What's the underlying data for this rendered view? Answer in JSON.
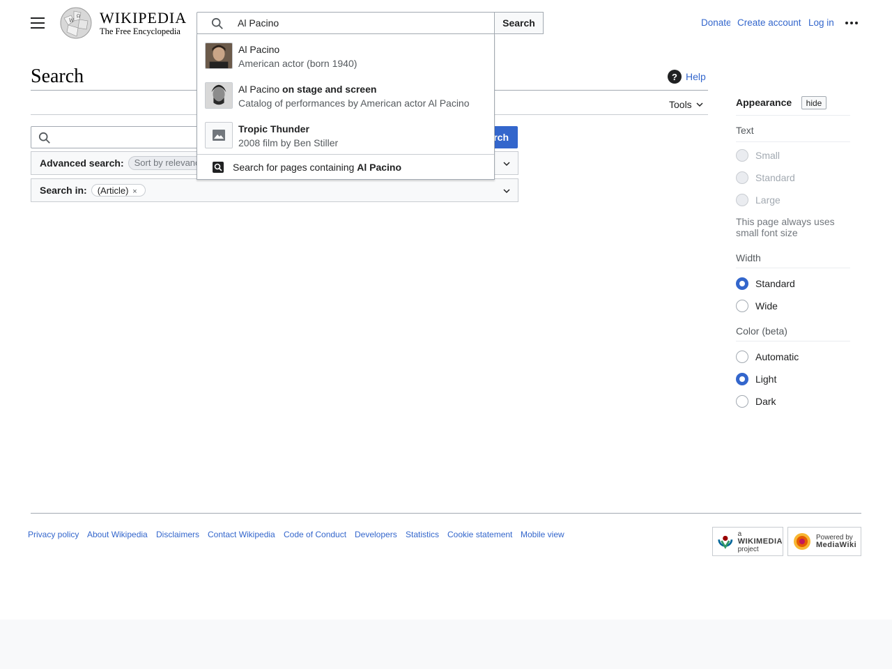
{
  "header": {
    "logo_word": "WIKIPEDIA",
    "logo_tagline": "The Free Encyclopedia",
    "search_value": "Al Pacino",
    "search_button": "Search",
    "links": {
      "donate": "Donate",
      "create_account": "Create account",
      "login": "Log in"
    }
  },
  "suggestions": {
    "items": [
      {
        "title": "Al Pacino",
        "title_suffix": "",
        "desc": "American actor (born 1940)"
      },
      {
        "title": "Al Pacino",
        "title_suffix": " on stage and screen",
        "desc": "Catalog of performances by American actor Al Pacino"
      },
      {
        "title": "Tropic Thunder",
        "title_suffix": "",
        "desc": "2008 film by Ben Stiller"
      }
    ],
    "full_text_prefix": "Search for pages containing ",
    "full_text_term": "Al Pacino"
  },
  "page": {
    "title": "Search",
    "help": "Help",
    "tools": "Tools"
  },
  "search_form": {
    "input_value": "",
    "button": "Search",
    "advanced_label": "Advanced search:",
    "sort_value": "Sort by relevance",
    "search_in_label": "Search in:",
    "namespace_chip": "(Article)",
    "namespace_remove": "×"
  },
  "appearance": {
    "heading": "Appearance",
    "hide": "hide",
    "text_label": "Text",
    "text_options": [
      "Small",
      "Standard",
      "Large"
    ],
    "text_note": "This page always uses small font size",
    "width_label": "Width",
    "width_options": [
      "Standard",
      "Wide"
    ],
    "color_label": "Color (beta)",
    "color_options": [
      "Automatic",
      "Light",
      "Dark"
    ]
  },
  "footer": {
    "links": {
      "privacy": "Privacy policy",
      "about": "About Wikipedia",
      "disclaimers": "Disclaimers",
      "contact": "Contact Wikipedia",
      "coc": "Code of Conduct",
      "developers": "Developers",
      "statistics": "Statistics",
      "cookie": "Cookie statement",
      "mobile": "Mobile view"
    },
    "wikimedia_badge_small": "a",
    "wikimedia_badge_big": "WIKIMEDIA",
    "wikimedia_badge_tail": "project",
    "mediawiki_badge_small": "Powered by",
    "mediawiki_badge_big": "MediaWiki"
  },
  "colors": {
    "link": "#3366cc",
    "progressive": "#3366cc",
    "border": "#a2a9b1"
  }
}
